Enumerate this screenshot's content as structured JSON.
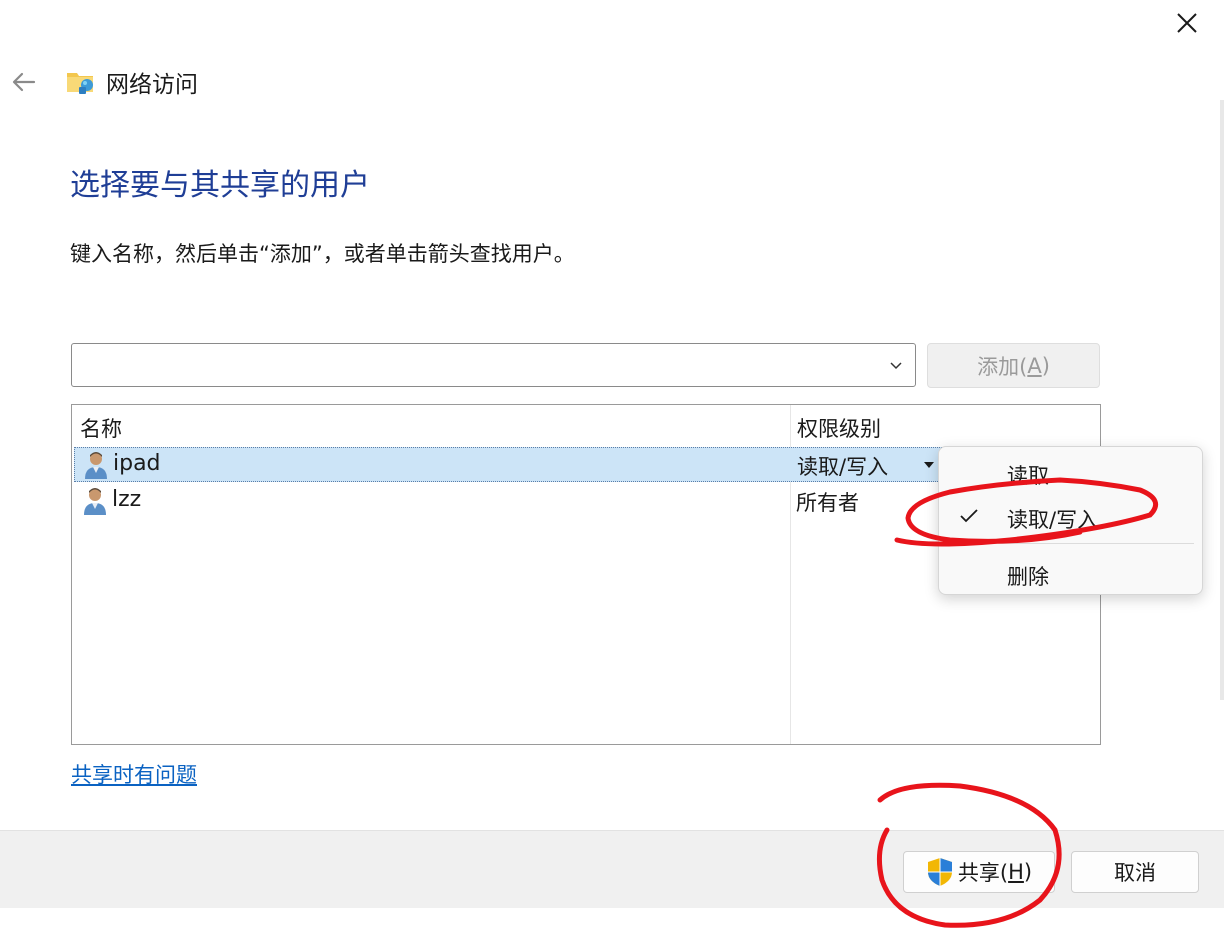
{
  "header": {
    "title": "网络访问",
    "back_icon": "back-arrow-icon",
    "app_icon": "network-folder-icon",
    "close_icon": "close-icon"
  },
  "main": {
    "heading": "选择要与其共享的用户",
    "instruction": "键入名称，然后单击“添加”，或者单击箭头查找用户。",
    "name_input": {
      "value": "",
      "placeholder": ""
    },
    "add_button": {
      "text": "添加(",
      "mnemonic": "A",
      "suffix": ")"
    }
  },
  "user_list": {
    "columns": [
      "名称",
      "权限级别"
    ],
    "rows": [
      {
        "name": "ipad",
        "permission": "读取/写入",
        "selected": true
      },
      {
        "name": "lzz",
        "permission": "所有者",
        "selected": false
      }
    ]
  },
  "context_menu": {
    "items": [
      {
        "label": "读取",
        "checked": false
      },
      {
        "label": "读取/写入",
        "checked": true
      },
      {
        "label": "删除",
        "checked": false
      }
    ]
  },
  "footer": {
    "trouble_link": "共享时有问题",
    "share_button": {
      "text": "共享(",
      "mnemonic": "H",
      "suffix": ")"
    },
    "cancel_button": "取消"
  },
  "colors": {
    "heading": "#1f3e96",
    "link": "#0a62c2",
    "selection": "#cce4f7",
    "annotation": "#e8141b"
  }
}
